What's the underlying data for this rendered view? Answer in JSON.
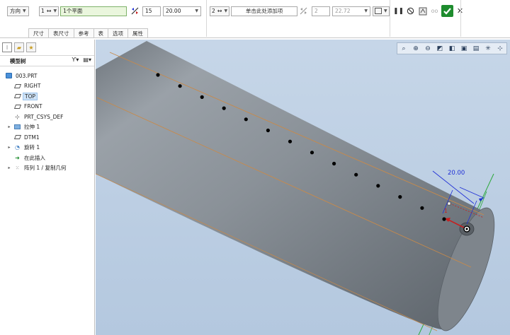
{
  "toolbar": {
    "direction_label": "方向",
    "ref_count": "1",
    "ref_field": "1个平面",
    "count_1": "15",
    "spacing_1": "20.00",
    "dir2_count": "2",
    "add_item_hint": "单击此处添加项",
    "count_2": "2",
    "spacing_2": "22.72",
    "tabs": [
      "尺寸",
      "表尺寸",
      "参考",
      "表",
      "选项",
      "属性"
    ],
    "icons": {
      "ref_type": "arrows-icon",
      "flip": "flip-direction-icon",
      "pause": "pause-icon",
      "no_preview": "no-preview-icon",
      "preview": "preview-icon",
      "glasses": "glasses-icon",
      "ok": "checkmark-icon",
      "cancel": "close-icon"
    }
  },
  "panel": {
    "title": "模型树",
    "tree": [
      {
        "label": "003.PRT",
        "icon": "part-icon",
        "level": 0,
        "expandable": false
      },
      {
        "label": "RIGHT",
        "icon": "datum-plane-icon",
        "level": 1,
        "expandable": false
      },
      {
        "label": "TOP",
        "icon": "datum-plane-icon",
        "level": 1,
        "expandable": false,
        "selected": true
      },
      {
        "label": "FRONT",
        "icon": "datum-plane-icon",
        "level": 1,
        "expandable": false
      },
      {
        "label": "PRT_CSYS_DEF",
        "icon": "csys-icon",
        "level": 1,
        "expandable": false
      },
      {
        "label": "拉伸 1",
        "icon": "extrude-icon",
        "level": 1,
        "expandable": true
      },
      {
        "label": "DTM1",
        "icon": "datum-plane-icon",
        "level": 1,
        "expandable": false
      },
      {
        "label": "旋转 1",
        "icon": "revolve-icon",
        "level": 1,
        "expandable": true
      },
      {
        "label": "在此插入",
        "icon": "insert-here-icon",
        "level": 1,
        "expandable": false
      },
      {
        "label": "阵列 1 / 复制几何",
        "icon": "pattern-icon",
        "level": 1,
        "expandable": true
      }
    ]
  },
  "viewport": {
    "dimension_label": "20.00",
    "direction_number": "1",
    "pattern_point_count": 14
  },
  "colors": {
    "accent": "#2f6fd6",
    "ok_green": "#1e8c2e",
    "dimension_blue": "#1f2fd6",
    "arrow_red": "#c81e1e",
    "cylinder": "#8f979f",
    "edge_orange": "#c88a4a"
  }
}
